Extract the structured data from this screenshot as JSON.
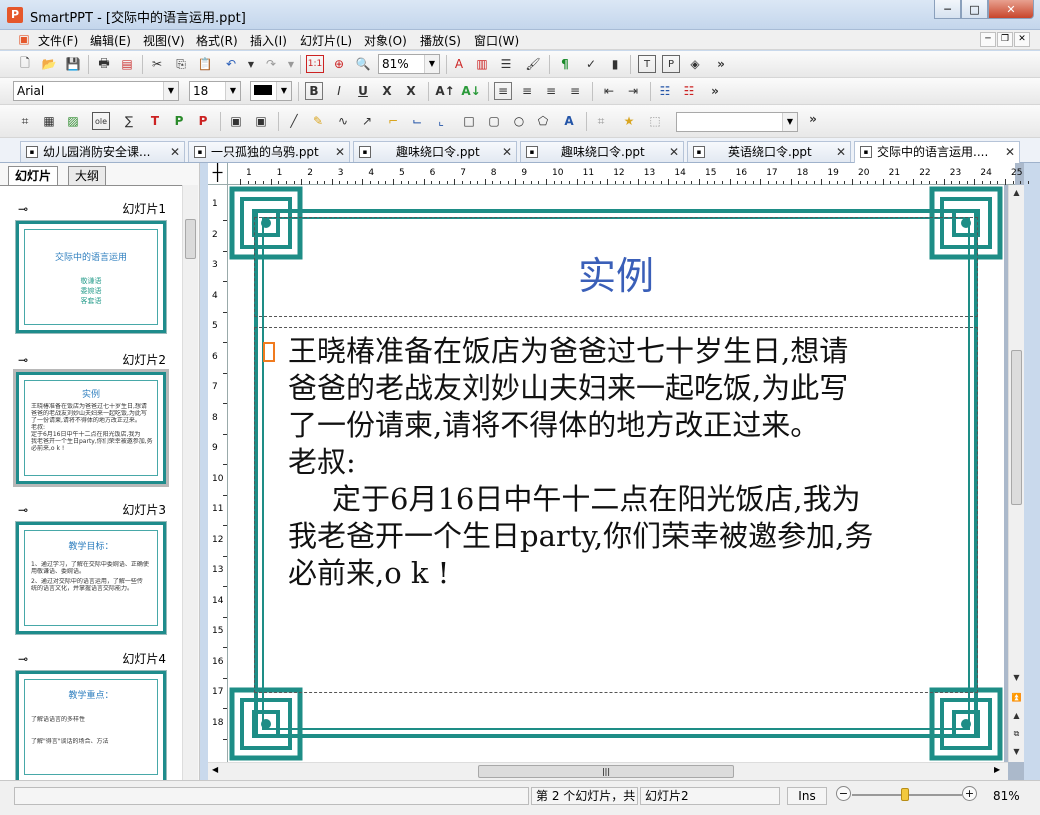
{
  "window": {
    "title": "SmartPPT - [交际中的语言运用.ppt]",
    "app_icon_letter": "P",
    "min": "─",
    "max": "□",
    "close": "✕"
  },
  "menu": {
    "items": [
      "文件(F)",
      "编辑(E)",
      "视图(V)",
      "格式(R)",
      "插入(I)",
      "幻灯片(L)",
      "对象(O)",
      "播放(S)",
      "窗口(W)"
    ]
  },
  "toolbar": {
    "zoom_value": "81%",
    "font_name": "Arial",
    "font_size": "18",
    "more": "»"
  },
  "tabs": [
    {
      "label": "幼儿园消防安全课..."
    },
    {
      "label": "一只孤独的乌鸦.ppt"
    },
    {
      "label": "趣味绕口令.ppt"
    },
    {
      "label": "趣味绕口令.ppt"
    },
    {
      "label": "英语绕口令.ppt"
    },
    {
      "label": "交际中的语言运用...."
    }
  ],
  "sidepanel": {
    "tab_slides": "幻灯片",
    "tab_outline": "大纲",
    "slides": [
      {
        "name": "幻灯片1",
        "thumb_title": "交际中的语言运用",
        "thumb_lines": [
          "敬谦语",
          "委婉语",
          "客套语"
        ]
      },
      {
        "name": "幻灯片2",
        "thumb_title": "实例",
        "thumb_lines": [
          "王晓椿准备在饭店为爸爸过七十岁生日,想请",
          "爸爸的老战友刘妙山夫妇来一起吃饭,为此写",
          "了一份请柬,请将不得体的地方改正过来。",
          "老叔:",
          "  定于6月16日中午十二点在阳光饭店,我为",
          "我老爸开一个生日party,你们荣幸被邀参加,务",
          "必前来,o k !"
        ]
      },
      {
        "name": "幻灯片3",
        "thumb_title": "教学目标：",
        "thumb_lines": [
          "1、通过学习，了解在交际中委婉语、正确使",
          "用敬谦语、委婉语。",
          "2、通过对交际中的语言运用，了解一些传",
          "统的语言文化，并掌握语言交际能力。"
        ]
      },
      {
        "name": "幻灯片4",
        "thumb_title": "教学重点：",
        "thumb_lines": [
          "了解语语言的多样性",
          "了解\"得言\"谈话的场合、方法"
        ]
      }
    ]
  },
  "ruler": {
    "h": [
      "1",
      "1",
      "2",
      "3",
      "4",
      "5",
      "6",
      "7",
      "8",
      "9",
      "10",
      "11",
      "12",
      "13",
      "14",
      "15",
      "16",
      "17",
      "18",
      "19",
      "20",
      "21",
      "22",
      "23",
      "24",
      "25"
    ],
    "v": [
      "1",
      "2",
      "3",
      "4",
      "5",
      "6",
      "7",
      "8",
      "9",
      "10",
      "11",
      "12",
      "13",
      "14",
      "15",
      "16",
      "17",
      "18"
    ]
  },
  "slide": {
    "title": "实例",
    "line1": "王晓椿准备在饭店为爸爸过七十岁生日,想请",
    "line2": "爸爸的老战友刘妙山夫妇来一起吃饭,为此写",
    "line3": "了一份请柬,请将不得体的地方改正过来。",
    "line4": "老叔:",
    "line5": "定于6月16日中午十二点在阳光饭店,我为",
    "line6": "我老爸开一个生日party,你们荣幸被邀参加,务",
    "line7": "必前来,o k !"
  },
  "status": {
    "position": "第 2 个幻灯片，共",
    "slide_name": "幻灯片2",
    "mode": "Ins",
    "zoom": "81%"
  },
  "colors": {
    "frame": "#1e8d86",
    "title": "#3a5fb8",
    "bullet": "#f07b1f"
  }
}
